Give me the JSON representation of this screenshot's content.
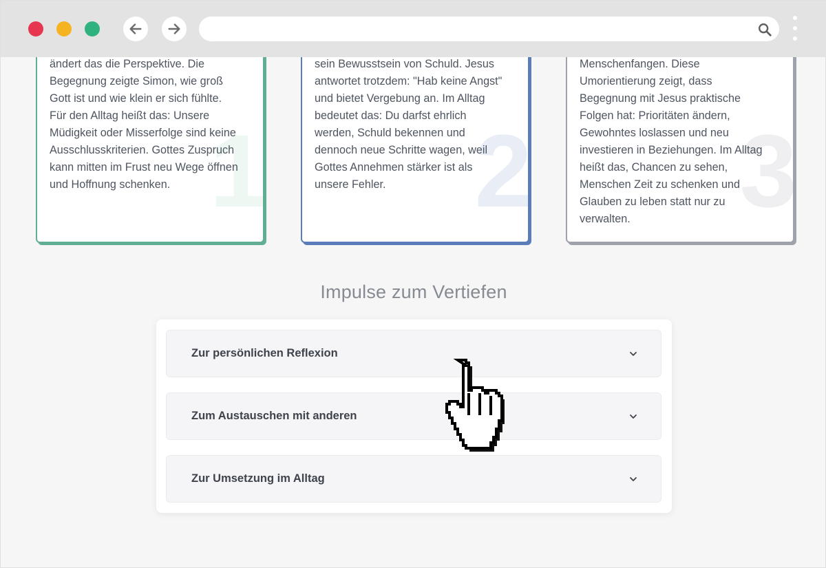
{
  "browser": {
    "url": ""
  },
  "cards": [
    {
      "number": "1",
      "text": "ändert das die Perspektive. Die\nBegegnung zeigte Simon, wie groß\nGott ist und wie klein er sich fühlte.\nFür den Alltag heißt das: Unsere\nMüdigkeit oder Misserfolge sind keine\nAusschlusskriterien. Gottes Zuspruch\nkann mitten im Frust neu Wege öffnen\nund Hoffnung schenken."
    },
    {
      "number": "2",
      "text": "sein Bewusstsein von Schuld. Jesus\nantwortet trotzdem: \"Hab keine Angst\"\nund bietet Vergebung an. Im Alltag\nbedeutet das: Du darfst ehrlich\nwerden, Schuld bekennen und\ndennoch neue Schritte wagen, weil\nGottes Annehmen stärker ist als\nunsere Fehler."
    },
    {
      "number": "3",
      "text": "Menschenfangen. Diese\nUmorientierung zeigt, dass\nBegegnung mit Jesus praktische\nFolgen hat: Prioritäten ändern,\nGewohntes loslassen und neu\ninvestieren in Beziehungen. Im Alltag\nheißt das, Chancen zu sehen,\nMenschen Zeit zu schenken und\nGlauben zu leben statt nur zu\nverwalten."
    }
  ],
  "section": {
    "title": "Impulse zum Vertiefen"
  },
  "accordion": {
    "items": [
      {
        "label": "Zur persönlichen Reflexion"
      },
      {
        "label": "Zum Austauschen mit anderen"
      },
      {
        "label": "Zur Umsetzung im Alltag"
      }
    ]
  },
  "colors": {
    "card1_accent": "#62ae94",
    "card2_accent": "#5a7db9",
    "card3_accent": "#9ea2ab",
    "traffic_red": "#e7364f",
    "traffic_yellow": "#f5b221",
    "traffic_green": "#2fb27d"
  },
  "icons": {
    "back": "arrow-left-icon",
    "forward": "arrow-right-icon",
    "search": "search-icon",
    "menu": "kebab-menu-icon",
    "chevron": "chevron-down-icon",
    "cursor": "hand-pointer-cursor-icon"
  }
}
